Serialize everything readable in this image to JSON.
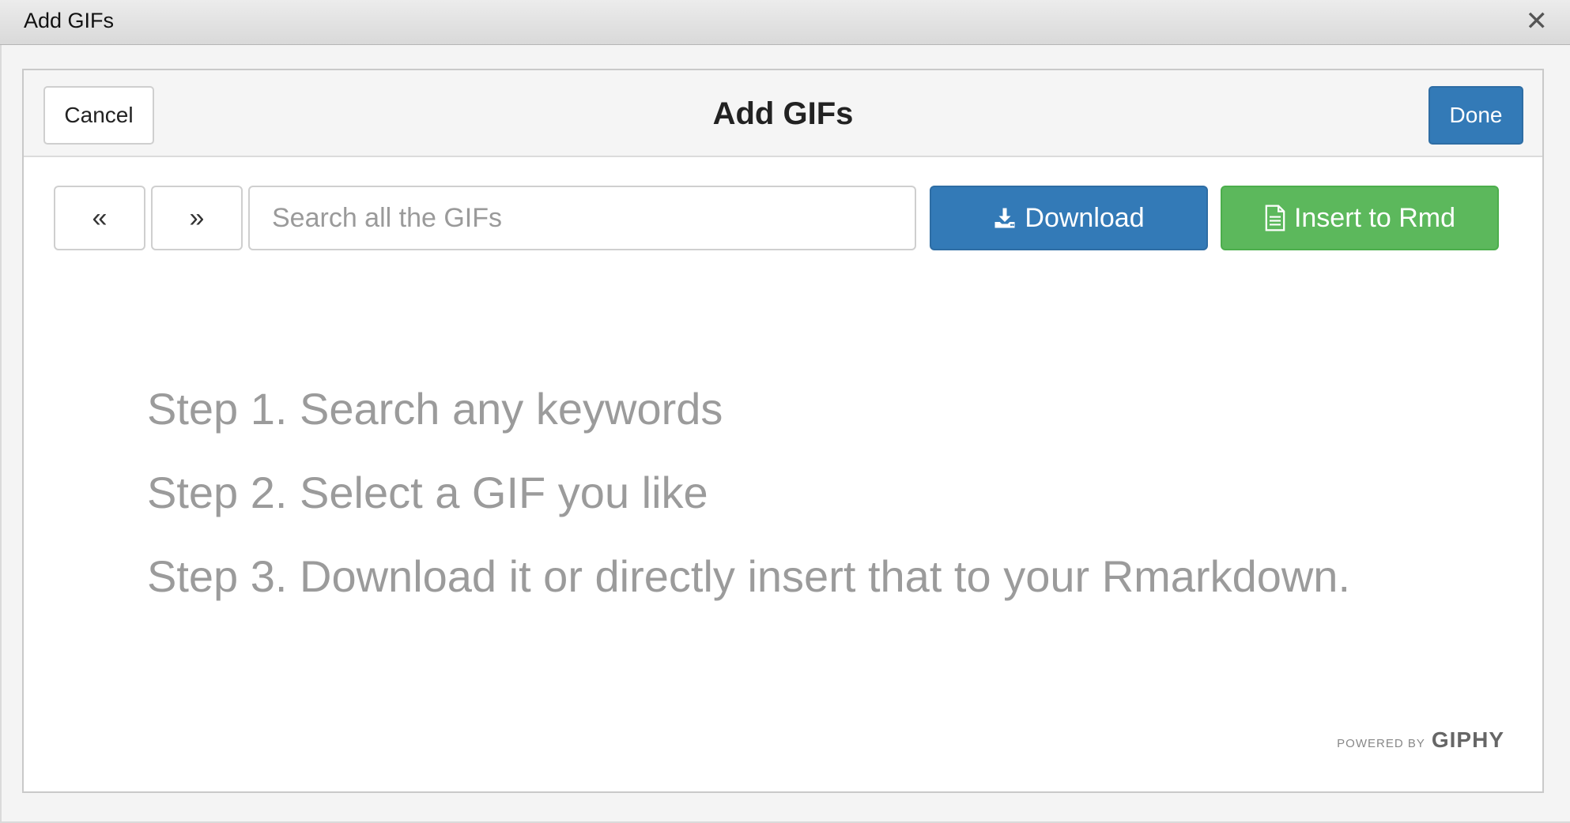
{
  "window": {
    "title": "Add GIFs",
    "close_icon": "close-icon"
  },
  "dialog": {
    "title": "Add GIFs",
    "cancel_label": "Cancel",
    "done_label": "Done"
  },
  "toolbar": {
    "prev_glyph": "«",
    "next_glyph": "»",
    "search": {
      "placeholder": "Search all the GIFs",
      "value": ""
    },
    "download_label": "Download",
    "download_icon": "download-icon",
    "insert_label": "Insert to Rmd",
    "insert_icon": "file-text-icon"
  },
  "instructions": [
    "Step 1. Search any keywords",
    "Step 2. Select a GIF you like",
    "Step 3. Download it or directly insert that to your Rmarkdown."
  ],
  "attribution": {
    "powered_by": "POWERED BY",
    "brand": "GIPHY"
  },
  "colors": {
    "primary": "#337ab7",
    "success": "#5cb85c",
    "muted_text": "#9b9b9b"
  }
}
